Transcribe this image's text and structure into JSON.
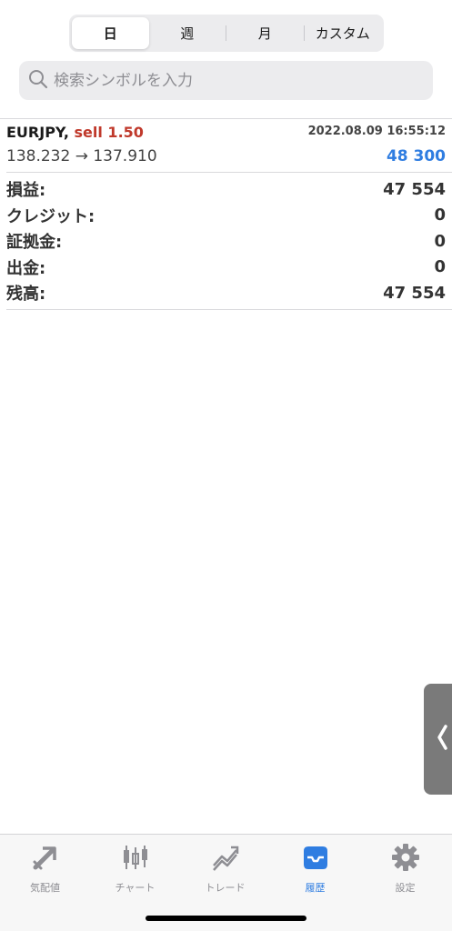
{
  "period_tabs": {
    "day": "日",
    "week": "週",
    "month": "月",
    "custom": "カスタム"
  },
  "search": {
    "placeholder": "検索シンボルを入力"
  },
  "trade": {
    "symbol": "EURJPY,",
    "side_size": "sell 1.50",
    "datetime": "2022.08.09 16:55:12",
    "prices": "138.232 → 137.910",
    "profit": "48 300"
  },
  "summary": [
    {
      "label": "損益:",
      "value": "47 554"
    },
    {
      "label": "クレジット:",
      "value": "0"
    },
    {
      "label": "証拠金:",
      "value": "0"
    },
    {
      "label": "出金:",
      "value": "0"
    },
    {
      "label": "残高:",
      "value": "47 554"
    }
  ],
  "tabbar": {
    "quotes": "気配値",
    "chart": "チャート",
    "trade": "トレード",
    "history": "履歴",
    "settings": "設定"
  },
  "colors": {
    "sell": "#c0392b",
    "profit": "#2f7de1",
    "active_tab": "#2f7de1",
    "inactive_tab": "#8e8e93"
  },
  "icons": {
    "search": "search-icon",
    "handle": "chevron-left-icon",
    "quotes": "quotes-arrow-icon",
    "chart": "candlestick-icon",
    "trade": "trade-trend-icon",
    "history": "inbox-tray-icon",
    "settings": "gear-icon"
  }
}
